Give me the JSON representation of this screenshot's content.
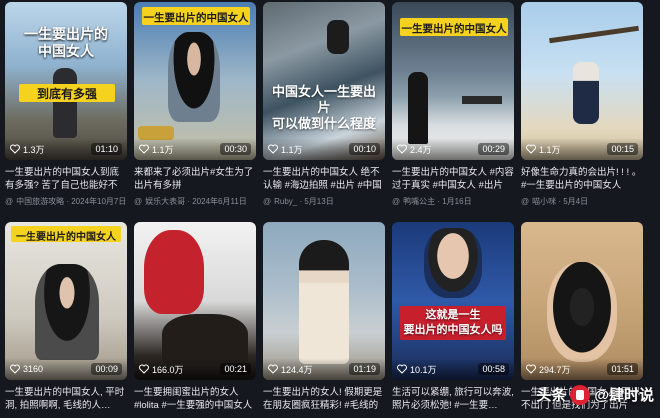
{
  "cards": [
    {
      "overlay_top": "一生要出片的\n中国女人",
      "overlay_mid": "到底有多强",
      "likes": "1.3万",
      "duration": "01:10",
      "title": "一生要出片的中国女人到底有多强? 苦了自己也能好不能…",
      "author": "中国旅游攻略 · 2024年10月7日"
    },
    {
      "overlay_top": "一生要出片的中国女人",
      "overlay_mid": "",
      "likes": "1.1万",
      "duration": "00:30",
      "title": "来都来了必须出片#女生为了出片有多拼",
      "author": "娱乐大表哥 · 2024年6月11日"
    },
    {
      "overlay_top": "",
      "overlay_mid": "中国女人一生要出片\n可以做到什么程度",
      "likes": "1.1万",
      "duration": "00:10",
      "title": "一生要出片的中国女人 绝不认输 #海边拍照 #出片 #中国女…",
      "author": "Ruby_ · 5月13日"
    },
    {
      "overlay_top": "一生要出片的中国女人",
      "overlay_mid": "",
      "likes": "2.4万",
      "duration": "00:29",
      "title": "一生要出片的中国女人 #内容过于真实 #中国女人 #出片 #…",
      "author": "鸭嘴公主 · 1月16日"
    },
    {
      "overlay_top": "",
      "overlay_mid": "",
      "likes": "1.1万",
      "duration": "00:15",
      "title": "好像生命力真的会出片! ! ! 。#一生要出片的中国女人",
      "author": "喵小咪 · 5月4日"
    },
    {
      "overlay_top": "一生要出片的中国女人",
      "overlay_mid": "",
      "likes": "3160",
      "duration": "00:09",
      "title": "一生要出片的中国女人, 平时洞, 拍照啊啊, 毛线的人…",
      "author": ""
    },
    {
      "overlay_top": "",
      "overlay_mid": "",
      "likes": "166.0万",
      "duration": "00:21",
      "title": "一生要拥闺蜜出片的女人 #lolita #一生要强的中国女人 #…",
      "author": ""
    },
    {
      "overlay_top": "",
      "overlay_mid": "",
      "likes": "124.4万",
      "duration": "01:19",
      "title": "一生要出片的女人! 假期更是在朋友圈疯狂精彩! #毛线的人…",
      "author": ""
    },
    {
      "overlay_top": "",
      "overlay_mid": "这就是一生\n要出片的中国女人吗",
      "likes": "10.1万",
      "duration": "00:58",
      "title": "生活可以紧绷, 旅行可以奔波, 照片必须松弛! #一生要…",
      "author": ""
    },
    {
      "overlay_top": "",
      "overlay_mid": "",
      "likes": "294.7万",
      "duration": "01:51",
      "title": "一生要出片的中国女人#可以不出门 但是找们为了出片有…",
      "author": ""
    }
  ],
  "watermark": {
    "brand": "头条",
    "handle": "@肆时说"
  },
  "colors": {
    "bg": "#16181f",
    "accent_yellow": "#f5d21e",
    "brand_red": "#d23"
  }
}
